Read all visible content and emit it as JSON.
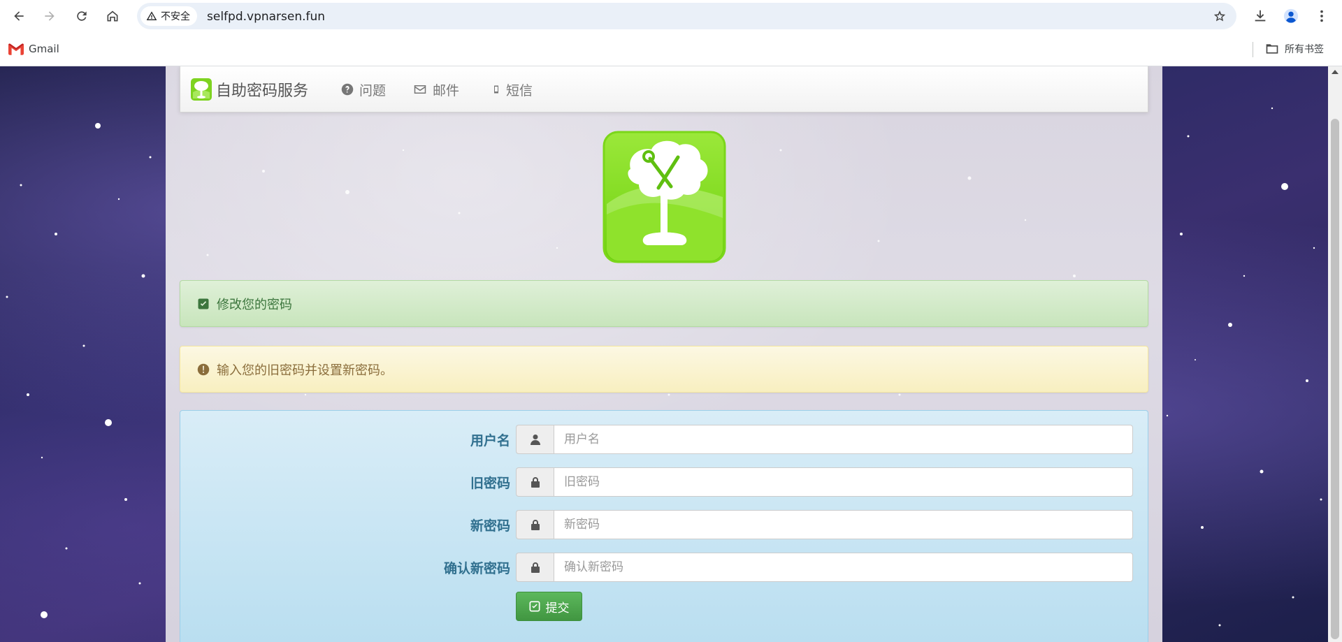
{
  "browser": {
    "security_label": "不安全",
    "url": "selfpd.vpnarsen.fun",
    "bookmarks": [
      {
        "label": "Gmail"
      }
    ],
    "all_bookmarks_label": "所有书签"
  },
  "navbar": {
    "brand": "自助密码服务",
    "items": [
      {
        "label": "问题",
        "icon": "question-circle-icon"
      },
      {
        "label": "邮件",
        "icon": "envelope-icon"
      },
      {
        "label": "短信",
        "icon": "mobile-phone-icon"
      }
    ]
  },
  "alerts": {
    "success": "修改您的密码",
    "warning": "输入您的旧密码并设置新密码。"
  },
  "form": {
    "fields": [
      {
        "label": "用户名",
        "placeholder": "用户名",
        "icon": "user-icon"
      },
      {
        "label": "旧密码",
        "placeholder": "旧密码",
        "icon": "lock-icon"
      },
      {
        "label": "新密码",
        "placeholder": "新密码",
        "icon": "lock-icon"
      },
      {
        "label": "确认新密码",
        "placeholder": "确认新密码",
        "icon": "lock-icon"
      }
    ],
    "submit_label": "提交"
  },
  "colors": {
    "success_text": "#3c763d",
    "warning_text": "#8a6d3b",
    "label_blue": "#31708f",
    "submit_green": "#5cb85c",
    "logo_green": "#7ed321"
  }
}
